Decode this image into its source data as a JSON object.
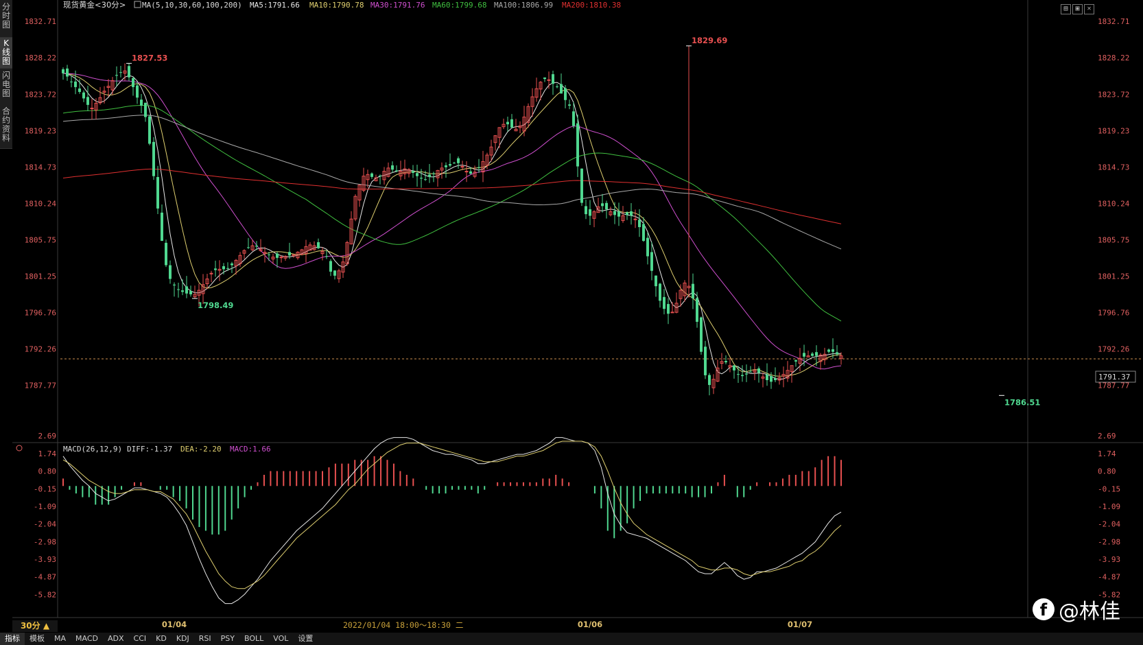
{
  "sidebar": {
    "tabs": [
      {
        "label": "分时图",
        "active": false
      },
      {
        "label": "K线图",
        "active": true
      },
      {
        "label": "闪电图",
        "active": false
      },
      {
        "label": "合约资料",
        "active": false
      }
    ]
  },
  "header": {
    "instrument": "现货黄金<30分>",
    "ma_def": "MA(5,10,30,60,100,200)",
    "ma_items": [
      {
        "label": "MA5:1791.66",
        "color": "#e8e8e8"
      },
      {
        "label": "MA10:1790.78",
        "color": "#e0d070"
      },
      {
        "label": "MA30:1791.76",
        "color": "#d050d0"
      },
      {
        "label": "MA60:1799.68",
        "color": "#40c040"
      },
      {
        "label": "MA100:1806.99",
        "color": "#aaaaaa"
      },
      {
        "label": "MA200:1810.38",
        "color": "#e03030"
      }
    ]
  },
  "macd_header": {
    "def": "MACD(26,12,9)",
    "diff": "DIFF:-1.37",
    "dea": "DEA:-2.20",
    "macd": "MACD:1.66"
  },
  "period_button": "30分 ▲",
  "current_price": "1791.37",
  "dates": [
    "01/04",
    "01/06",
    "01/07"
  ],
  "crosshair_time": "2022/01/04 18:00～18:30 二",
  "toolbar": [
    "指标",
    "模板",
    "MA",
    "MACD",
    "ADX",
    "CCI",
    "KD",
    "KDJ",
    "RSI",
    "PSY",
    "BOLL",
    "VOL",
    "设置"
  ],
  "watermark": "@林佳",
  "colors": {
    "up": "#e85050",
    "down": "#50d890",
    "axis_price": "#e06060",
    "dash": "#d09050"
  },
  "chart_data": {
    "type": "candlestick",
    "title": "现货黄金<30分>",
    "price_axis_ticks": [
      1832.71,
      1828.22,
      1823.72,
      1819.23,
      1814.73,
      1810.24,
      1805.75,
      1801.25,
      1796.76,
      1792.26,
      1787.77
    ],
    "price_axis_labels": [
      "1832.71",
      "1828.22",
      "1823.72",
      "1819.23",
      "1814.73",
      "1810.24",
      "1805.75",
      "1801.25",
      "1796.76",
      "1792.26",
      "1787.77"
    ],
    "ylim": [
      1784.5,
      1834.0
    ],
    "annotations": [
      {
        "label": "1827.53",
        "bar": 16,
        "price": 1827.53,
        "kind": "high"
      },
      {
        "label": "1798.49",
        "bar": 32,
        "price": 1798.49,
        "kind": "low"
      },
      {
        "label": "1829.69",
        "bar": 152,
        "price": 1829.69,
        "kind": "high"
      },
      {
        "label": "1786.51",
        "bar": 228,
        "price": 1786.51,
        "kind": "low"
      }
    ],
    "last_price": 1791.37,
    "closes": [
      1826.3,
      1825.9,
      1825.2,
      1824.6,
      1824.0,
      1823.2,
      1822.4,
      1822.0,
      1822.6,
      1823.3,
      1824.1,
      1824.7,
      1825.4,
      1826.0,
      1826.4,
      1826.6,
      1825.8,
      1824.6,
      1823.3,
      1822.3,
      1820.9,
      1817.6,
      1813.6,
      1809.6,
      1805.6,
      1802.6,
      1800.9,
      1800.1,
      1799.6,
      1799.3,
      1799.1,
      1799.0,
      1799.0,
      1799.5,
      1800.2,
      1800.9,
      1801.6,
      1802.0,
      1802.1,
      1802.1,
      1802.2,
      1802.6,
      1803.2,
      1803.8,
      1804.4,
      1804.8,
      1805.0,
      1804.9,
      1804.6,
      1804.2,
      1803.9,
      1803.6,
      1803.5,
      1803.6,
      1803.7,
      1803.8,
      1803.9,
      1804.2,
      1804.5,
      1804.9,
      1805.1,
      1805.0,
      1804.7,
      1804.3,
      1803.7,
      1801.8,
      1801.3,
      1801.9,
      1803.0,
      1805.4,
      1808.3,
      1811.1,
      1812.5,
      1813.6,
      1813.8,
      1813.5,
      1813.4,
      1813.6,
      1814.2,
      1814.6,
      1814.4,
      1814.2,
      1814.2,
      1814.5,
      1814.4,
      1814.0,
      1813.6,
      1813.3,
      1813.2,
      1813.5,
      1813.9,
      1814.3,
      1814.6,
      1814.7,
      1814.9,
      1815.2,
      1815.2,
      1814.8,
      1814.2,
      1813.9,
      1814.1,
      1814.7,
      1815.4,
      1816.2,
      1817.2,
      1818.6,
      1819.6,
      1820.0,
      1820.0,
      1819.6,
      1819.4,
      1819.8,
      1820.9,
      1822.2,
      1823.4,
      1824.4,
      1825.2,
      1825.6,
      1825.5,
      1825.0,
      1824.6,
      1823.8,
      1823.0,
      1822.3,
      1819.8,
      1814.8,
      1810.3,
      1808.9,
      1808.7,
      1809.2,
      1809.8,
      1809.9,
      1809.5,
      1809.2,
      1808.8,
      1808.6,
      1808.7,
      1808.8,
      1808.7,
      1808.3,
      1807.3,
      1805.6,
      1803.7,
      1801.9,
      1800.0,
      1798.2,
      1797.2,
      1796.6,
      1796.8,
      1797.9,
      1799.5,
      1800.4,
      1800.0,
      1798.5,
      1795.6,
      1791.9,
      1789.0,
      1787.8,
      1788.5,
      1789.9,
      1790.7,
      1790.6,
      1790.2,
      1789.6,
      1789.1,
      1788.9,
      1789.1,
      1789.4,
      1789.6,
      1789.3,
      1788.8,
      1788.4,
      1788.2,
      1788.4,
      1788.7,
      1789.1,
      1789.6,
      1790.2,
      1790.7,
      1791.1,
      1791.3,
      1791.4,
      1791.4,
      1791.4,
      1791.5,
      1791.6,
      1791.9,
      1791.9,
      1791.6,
      1791.4
    ],
    "ma_series": [
      {
        "name": "MA5",
        "color": "#e8e8e8"
      },
      {
        "name": "MA10",
        "color": "#e0d070"
      },
      {
        "name": "MA30",
        "color": "#d050d0"
      },
      {
        "name": "MA60",
        "color": "#40c040"
      },
      {
        "name": "MA100",
        "color": "#aaaaaa"
      },
      {
        "name": "MA200",
        "color": "#e03030"
      }
    ],
    "macd": {
      "axis_ticks": [
        2.69,
        1.74,
        0.8,
        -0.15,
        -1.09,
        -2.04,
        -2.98,
        -3.93,
        -4.87,
        -5.82
      ],
      "axis_labels": [
        "2.69",
        "1.74",
        "0.80",
        "-0.15",
        "-1.09",
        "-2.04",
        "-2.98",
        "-3.93",
        "-4.87",
        "-5.82"
      ],
      "ylim": [
        -6.5,
        3.1
      ],
      "diff": [
        1.6,
        1.1,
        0.7,
        0.3,
        0.0,
        -0.4,
        -0.6,
        -0.8,
        -0.7,
        -0.5,
        -0.3,
        -0.1,
        -0.1,
        -0.2,
        -0.3,
        -0.4,
        -0.6,
        -1.0,
        -1.5,
        -2.1,
        -3.0,
        -3.9,
        -4.7,
        -5.4,
        -6.0,
        -6.3,
        -6.3,
        -6.1,
        -5.8,
        -5.4,
        -5.0,
        -4.5,
        -4.0,
        -3.6,
        -3.2,
        -2.8,
        -2.4,
        -2.1,
        -1.8,
        -1.5,
        -1.2,
        -0.8,
        -0.4,
        0.0,
        0.4,
        0.8,
        1.2,
        1.6,
        2.0,
        2.3,
        2.5,
        2.6,
        2.6,
        2.6,
        2.5,
        2.3,
        2.1,
        1.9,
        1.8,
        1.7,
        1.7,
        1.6,
        1.5,
        1.4,
        1.2,
        1.2,
        1.3,
        1.4,
        1.5,
        1.6,
        1.7,
        1.7,
        1.8,
        1.9,
        2.1,
        2.3,
        2.6,
        2.6,
        2.5,
        2.4,
        2.4,
        2.3,
        1.9,
        1.0,
        -0.4,
        -1.5,
        -2.1,
        -2.5,
        -2.6,
        -2.7,
        -2.8,
        -3.0,
        -3.2,
        -3.4,
        -3.6,
        -3.8,
        -4.0,
        -4.3,
        -4.6,
        -4.7,
        -4.7,
        -4.4,
        -4.1,
        -4.4,
        -4.8,
        -5.0,
        -4.9,
        -4.6,
        -4.6,
        -4.5,
        -4.4,
        -4.2,
        -4.0,
        -3.8,
        -3.6,
        -3.3,
        -3.0,
        -2.5,
        -2.0,
        -1.6,
        -1.4
      ],
      "dea": [
        1.4,
        1.2,
        0.9,
        0.6,
        0.3,
        0.1,
        -0.1,
        -0.3,
        -0.4,
        -0.4,
        -0.3,
        -0.2,
        -0.2,
        -0.2,
        -0.3,
        -0.3,
        -0.5,
        -0.7,
        -1.1,
        -1.5,
        -2.1,
        -2.8,
        -3.5,
        -4.1,
        -4.7,
        -5.1,
        -5.4,
        -5.5,
        -5.5,
        -5.3,
        -5.1,
        -4.8,
        -4.4,
        -4.0,
        -3.6,
        -3.2,
        -2.8,
        -2.5,
        -2.2,
        -1.9,
        -1.6,
        -1.3,
        -1.0,
        -0.6,
        -0.2,
        0.1,
        0.5,
        0.9,
        1.2,
        1.5,
        1.8,
        2.0,
        2.2,
        2.3,
        2.3,
        2.3,
        2.2,
        2.1,
        2.0,
        1.9,
        1.8,
        1.7,
        1.6,
        1.5,
        1.4,
        1.3,
        1.3,
        1.3,
        1.4,
        1.5,
        1.6,
        1.6,
        1.7,
        1.8,
        1.9,
        2.1,
        2.3,
        2.4,
        2.4,
        2.4,
        2.4,
        2.3,
        2.1,
        1.6,
        0.8,
        -0.1,
        -0.9,
        -1.5,
        -2.0,
        -2.3,
        -2.6,
        -2.8,
        -3.0,
        -3.2,
        -3.4,
        -3.6,
        -3.8,
        -4.0,
        -4.3,
        -4.4,
        -4.5,
        -4.5,
        -4.4,
        -4.4,
        -4.5,
        -4.7,
        -4.8,
        -4.7,
        -4.6,
        -4.6,
        -4.5,
        -4.4,
        -4.3,
        -4.1,
        -4.0,
        -3.7,
        -3.5,
        -3.2,
        -2.8,
        -2.4,
        -2.1
      ]
    }
  }
}
